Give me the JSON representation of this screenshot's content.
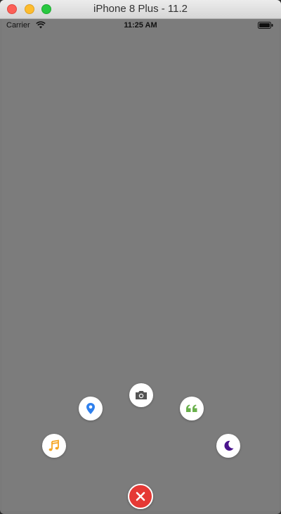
{
  "window": {
    "title": "iPhone 8 Plus - 11.2"
  },
  "status_bar": {
    "carrier": "Carrier",
    "time": "11:25 AM",
    "icons": [
      "wifi-icon",
      "battery-icon"
    ]
  },
  "radial_menu": {
    "items": [
      {
        "name": "music",
        "icon": "music-note-icon",
        "color": "#f5a623"
      },
      {
        "name": "location",
        "icon": "location-pin-icon",
        "color": "#2f80ed"
      },
      {
        "name": "camera",
        "icon": "camera-icon",
        "color": "#555555"
      },
      {
        "name": "quote",
        "icon": "quote-icon",
        "color": "#6ab04c"
      },
      {
        "name": "night",
        "icon": "moon-icon",
        "color": "#4a148c"
      }
    ],
    "close": {
      "icon": "close-icon",
      "color": "#e53935"
    }
  },
  "colors": {
    "background_overlay": "#7c7c7c"
  }
}
